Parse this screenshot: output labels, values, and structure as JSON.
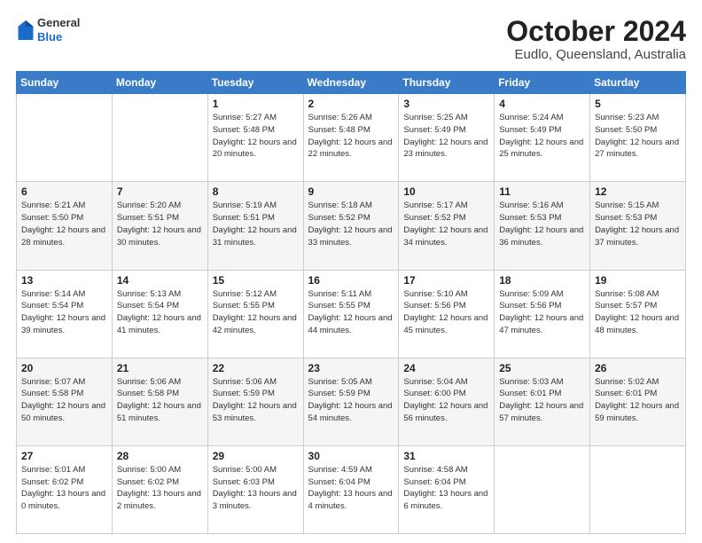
{
  "header": {
    "logo": {
      "general": "General",
      "blue": "Blue",
      "icon_title": "GeneralBlue logo"
    },
    "title": "October 2024",
    "subtitle": "Eudlo, Queensland, Australia"
  },
  "calendar": {
    "days_of_week": [
      "Sunday",
      "Monday",
      "Tuesday",
      "Wednesday",
      "Thursday",
      "Friday",
      "Saturday"
    ],
    "weeks": [
      [
        {
          "day": "",
          "details": ""
        },
        {
          "day": "",
          "details": ""
        },
        {
          "day": "1",
          "details": "Sunrise: 5:27 AM\nSunset: 5:48 PM\nDaylight: 12 hours\nand 20 minutes."
        },
        {
          "day": "2",
          "details": "Sunrise: 5:26 AM\nSunset: 5:48 PM\nDaylight: 12 hours\nand 22 minutes."
        },
        {
          "day": "3",
          "details": "Sunrise: 5:25 AM\nSunset: 5:49 PM\nDaylight: 12 hours\nand 23 minutes."
        },
        {
          "day": "4",
          "details": "Sunrise: 5:24 AM\nSunset: 5:49 PM\nDaylight: 12 hours\nand 25 minutes."
        },
        {
          "day": "5",
          "details": "Sunrise: 5:23 AM\nSunset: 5:50 PM\nDaylight: 12 hours\nand 27 minutes."
        }
      ],
      [
        {
          "day": "6",
          "details": "Sunrise: 5:21 AM\nSunset: 5:50 PM\nDaylight: 12 hours\nand 28 minutes."
        },
        {
          "day": "7",
          "details": "Sunrise: 5:20 AM\nSunset: 5:51 PM\nDaylight: 12 hours\nand 30 minutes."
        },
        {
          "day": "8",
          "details": "Sunrise: 5:19 AM\nSunset: 5:51 PM\nDaylight: 12 hours\nand 31 minutes."
        },
        {
          "day": "9",
          "details": "Sunrise: 5:18 AM\nSunset: 5:52 PM\nDaylight: 12 hours\nand 33 minutes."
        },
        {
          "day": "10",
          "details": "Sunrise: 5:17 AM\nSunset: 5:52 PM\nDaylight: 12 hours\nand 34 minutes."
        },
        {
          "day": "11",
          "details": "Sunrise: 5:16 AM\nSunset: 5:53 PM\nDaylight: 12 hours\nand 36 minutes."
        },
        {
          "day": "12",
          "details": "Sunrise: 5:15 AM\nSunset: 5:53 PM\nDaylight: 12 hours\nand 37 minutes."
        }
      ],
      [
        {
          "day": "13",
          "details": "Sunrise: 5:14 AM\nSunset: 5:54 PM\nDaylight: 12 hours\nand 39 minutes."
        },
        {
          "day": "14",
          "details": "Sunrise: 5:13 AM\nSunset: 5:54 PM\nDaylight: 12 hours\nand 41 minutes."
        },
        {
          "day": "15",
          "details": "Sunrise: 5:12 AM\nSunset: 5:55 PM\nDaylight: 12 hours\nand 42 minutes."
        },
        {
          "day": "16",
          "details": "Sunrise: 5:11 AM\nSunset: 5:55 PM\nDaylight: 12 hours\nand 44 minutes."
        },
        {
          "day": "17",
          "details": "Sunrise: 5:10 AM\nSunset: 5:56 PM\nDaylight: 12 hours\nand 45 minutes."
        },
        {
          "day": "18",
          "details": "Sunrise: 5:09 AM\nSunset: 5:56 PM\nDaylight: 12 hours\nand 47 minutes."
        },
        {
          "day": "19",
          "details": "Sunrise: 5:08 AM\nSunset: 5:57 PM\nDaylight: 12 hours\nand 48 minutes."
        }
      ],
      [
        {
          "day": "20",
          "details": "Sunrise: 5:07 AM\nSunset: 5:58 PM\nDaylight: 12 hours\nand 50 minutes."
        },
        {
          "day": "21",
          "details": "Sunrise: 5:06 AM\nSunset: 5:58 PM\nDaylight: 12 hours\nand 51 minutes."
        },
        {
          "day": "22",
          "details": "Sunrise: 5:06 AM\nSunset: 5:59 PM\nDaylight: 12 hours\nand 53 minutes."
        },
        {
          "day": "23",
          "details": "Sunrise: 5:05 AM\nSunset: 5:59 PM\nDaylight: 12 hours\nand 54 minutes."
        },
        {
          "day": "24",
          "details": "Sunrise: 5:04 AM\nSunset: 6:00 PM\nDaylight: 12 hours\nand 56 minutes."
        },
        {
          "day": "25",
          "details": "Sunrise: 5:03 AM\nSunset: 6:01 PM\nDaylight: 12 hours\nand 57 minutes."
        },
        {
          "day": "26",
          "details": "Sunrise: 5:02 AM\nSunset: 6:01 PM\nDaylight: 12 hours\nand 59 minutes."
        }
      ],
      [
        {
          "day": "27",
          "details": "Sunrise: 5:01 AM\nSunset: 6:02 PM\nDaylight: 13 hours\nand 0 minutes."
        },
        {
          "day": "28",
          "details": "Sunrise: 5:00 AM\nSunset: 6:02 PM\nDaylight: 13 hours\nand 2 minutes."
        },
        {
          "day": "29",
          "details": "Sunrise: 5:00 AM\nSunset: 6:03 PM\nDaylight: 13 hours\nand 3 minutes."
        },
        {
          "day": "30",
          "details": "Sunrise: 4:59 AM\nSunset: 6:04 PM\nDaylight: 13 hours\nand 4 minutes."
        },
        {
          "day": "31",
          "details": "Sunrise: 4:58 AM\nSunset: 6:04 PM\nDaylight: 13 hours\nand 6 minutes."
        },
        {
          "day": "",
          "details": ""
        },
        {
          "day": "",
          "details": ""
        }
      ]
    ]
  }
}
